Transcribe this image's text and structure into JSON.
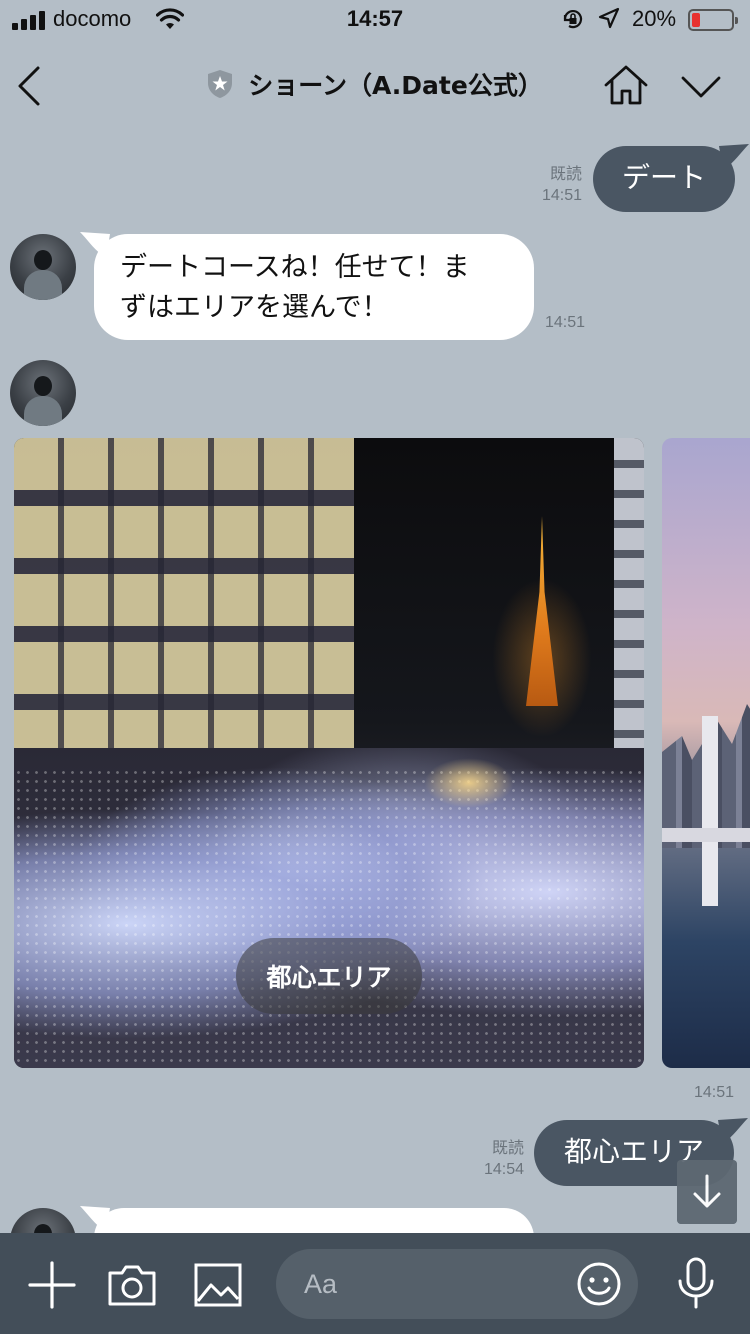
{
  "status_bar": {
    "carrier": "docomo",
    "time": "14:57",
    "battery_percent": "20%",
    "battery_level": 0.2,
    "battery_color": "#e8312f"
  },
  "header": {
    "title": "ショーン（A.Date公式）",
    "back_icon": "chevron-left-icon",
    "badge_icon": "official-star-shield-icon",
    "home_icon": "home-icon",
    "menu_icon": "chevron-down-icon"
  },
  "messages": [
    {
      "direction": "out",
      "text": "デート",
      "read_label": "既読",
      "time": "14:51"
    },
    {
      "direction": "in",
      "text_line1": "デートコースね！任せて！ま",
      "text_line2": "ずはエリアを選んで！",
      "time": "14:51"
    },
    {
      "direction": "in",
      "type": "carousel",
      "cards": [
        {
          "label": "都心エリア"
        }
      ],
      "time": "14:51"
    },
    {
      "direction": "out",
      "text": "都心エリア",
      "read_label": "既読",
      "time": "14:54"
    }
  ],
  "toolbar": {
    "input_placeholder": "Aa",
    "icons": [
      "plus-icon",
      "camera-icon",
      "image-icon",
      "emoji-icon",
      "microphone-icon"
    ]
  },
  "colors": {
    "chat_background": "#b4bec7",
    "outgoing_bubble": "#4a5663",
    "incoming_bubble": "#ffffff",
    "toolbar": "#434e59"
  }
}
